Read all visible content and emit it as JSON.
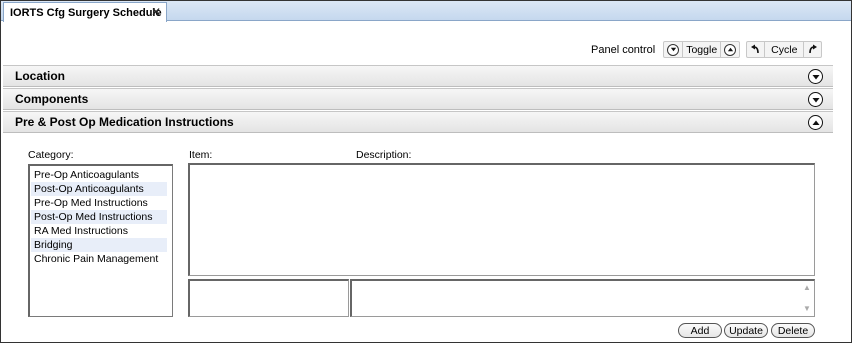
{
  "tab": {
    "title": "IORTS Cfg Surgery Schedule",
    "close_glyph": "✕"
  },
  "panel_control": {
    "label": "Panel control",
    "toggle_label": "Toggle",
    "cycle_label": "Cycle"
  },
  "sections": {
    "location": "Location",
    "components": "Components",
    "medication": "Pre & Post Op Medication Instructions"
  },
  "form": {
    "category_label": "Category:",
    "item_label": "Item:",
    "description_label": "Description:"
  },
  "categories": [
    "Pre-Op Anticoagulants",
    "Post-Op Anticoagulants",
    "Pre-Op Med Instructions",
    "Post-Op Med Instructions",
    "RA Med Instructions",
    "Bridging",
    "Chronic Pain Management"
  ],
  "buttons": {
    "add": "Add",
    "update": "Update",
    "delete": "Delete"
  },
  "icons": {
    "collapse": "chevron-down-circle-icon",
    "expand": "chevron-up-circle-icon",
    "undo": "rotate-left-icon",
    "redo": "rotate-right-icon"
  }
}
